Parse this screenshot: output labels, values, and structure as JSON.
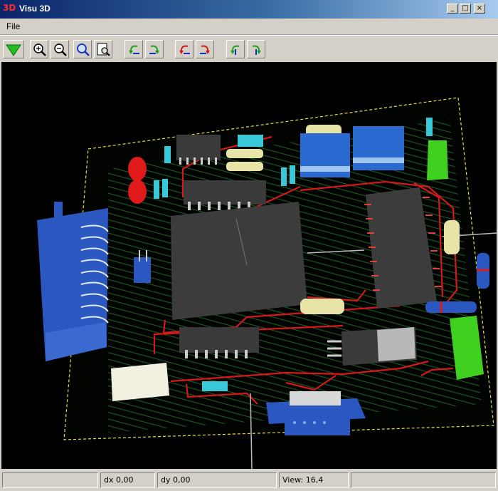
{
  "window": {
    "app_icon_text": "3D",
    "title": "Visu 3D",
    "minimize_glyph": "_",
    "maximize_glyph": "□",
    "close_glyph": "×"
  },
  "menu": {
    "items": [
      {
        "label": "File"
      }
    ]
  },
  "toolbar": {
    "buttons": [
      {
        "icon": "green-down-arrow-icon"
      },
      {
        "icon": "zoom-in-icon"
      },
      {
        "icon": "zoom-out-icon"
      },
      {
        "icon": "zoom-fit-icon"
      },
      {
        "icon": "zoom-page-icon"
      },
      {
        "icon": "rotate-x-ccw-icon"
      },
      {
        "icon": "rotate-x-cw-icon"
      },
      {
        "icon": "rotate-y-ccw-icon"
      },
      {
        "icon": "rotate-y-cw-icon"
      },
      {
        "icon": "rotate-z-ccw-icon"
      },
      {
        "icon": "rotate-z-cw-icon"
      }
    ]
  },
  "viewport": {
    "description_icon": "pcb-3d-board-render",
    "colors": {
      "background": "#000000",
      "board_outline": "#e8e040",
      "traces": "#1f6b2a",
      "trace_red": "#d81818",
      "connector_blue": "#2a58c0",
      "chip_gray": "#3a3a3a",
      "capacitor_cyan": "#38c8d8",
      "led_red": "#e01a1a",
      "resistor_cream": "#e8e4a8",
      "component_green": "#40d020"
    }
  },
  "status": {
    "pane1": "",
    "dx": "dx 0,00",
    "dy": "dy 0,00",
    "pane4": "",
    "view": "View: 16,4"
  }
}
